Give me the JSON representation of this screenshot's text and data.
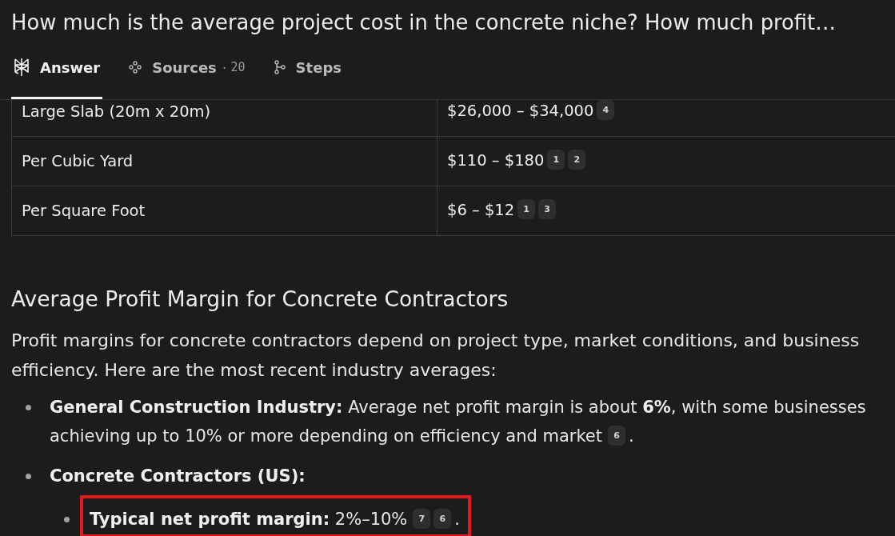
{
  "title": "How much is the average project cost in the concrete niche? How much profit…",
  "tabs": [
    {
      "label": "Answer",
      "selected": true
    },
    {
      "label": "Sources",
      "separator": "·",
      "count": "20",
      "selected": false
    },
    {
      "label": "Steps",
      "selected": false
    }
  ],
  "table": {
    "rows": [
      {
        "column_1": "Large Slab (20m x 20m)",
        "column_2": "$26,000 – $34,000",
        "citations": [
          "4"
        ]
      },
      {
        "column_1": "Per Cubic Yard",
        "column_2": "$110 – $180",
        "citations": [
          "1",
          "2"
        ]
      },
      {
        "column_1": "Per Square Foot",
        "column_2": "$6 – $12",
        "citations": [
          "1",
          "3"
        ]
      }
    ]
  },
  "section": {
    "heading": "Average Profit Margin for Concrete Contractors",
    "paragraph": "Profit margins for concrete contractors depend on project type, market conditions, and business efficiency. Here are the most recent industry averages:",
    "bullets": [
      {
        "label": "General Construction Industry:",
        "text": "Average net profit margin is about **6%**, with some businesses achieving up to 10% or more depending on efficiency and market",
        "citations": [
          "6"
        ],
        "end": ".",
        "highlighted": false
      },
      {
        "label": "Concrete Contractors (US):",
        "highlighted": false,
        "children": [
          {
            "label": "Typical net profit margin:",
            "text": "2%–10%",
            "citations": [
              "7",
              "6"
            ],
            "end": ".",
            "highlighted": true
          }
        ]
      }
    ]
  }
}
